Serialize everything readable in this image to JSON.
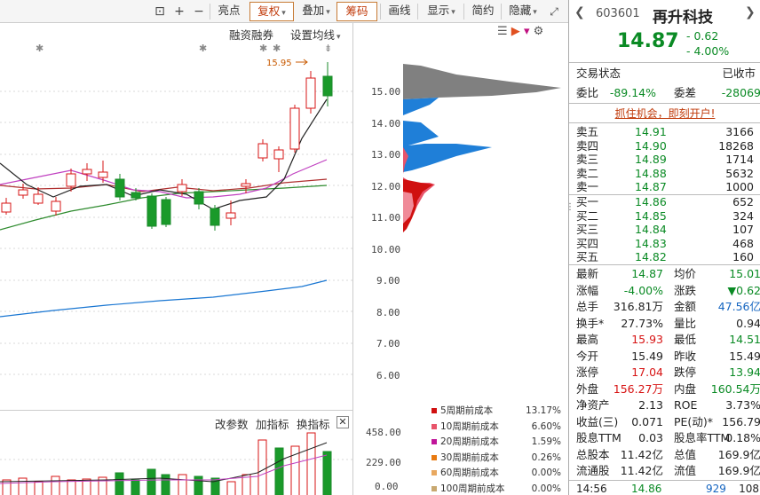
{
  "toolbar": {
    "buttons": [
      "亮点",
      "复权",
      "叠加",
      "筹码",
      "画线",
      "显示",
      "简约",
      "隐藏"
    ]
  },
  "chart": {
    "margin_label": "融资融券",
    "ma_label": "设置均线",
    "price_annotation": "15.95",
    "price_ticks": [
      "15.00",
      "14.00",
      "13.00",
      "12.00",
      "11.00",
      "10.00",
      "9.00",
      "8.00",
      "7.00",
      "6.00"
    ]
  },
  "volume": {
    "buttons": [
      "改参数",
      "加指标",
      "换指标"
    ],
    "ticks": [
      "458.00",
      "229.00",
      "0.00"
    ]
  },
  "chip_legend": [
    {
      "label": "5周期前成本",
      "pct": "13.17%",
      "color": "#d01010"
    },
    {
      "label": "10周期前成本",
      "pct": "6.60%",
      "color": "#e8546a"
    },
    {
      "label": "20周期前成本",
      "pct": "1.59%",
      "color": "#c0159a"
    },
    {
      "label": "30周期前成本",
      "pct": "0.26%",
      "color": "#e87a10"
    },
    {
      "label": "60周期前成本",
      "pct": "0.00%",
      "color": "#e8a860"
    },
    {
      "label": "100周期前成本",
      "pct": "0.00%",
      "color": "#c8a870"
    }
  ],
  "quote": {
    "code": "603601",
    "name": "再升科技",
    "price": "14.87",
    "change": "- 0.62",
    "change_pct": "- 4.00%",
    "trade_state_label": "交易状态",
    "trade_state": "已收市",
    "weibi_label": "委比",
    "weibi": "-89.14%",
    "weicha_label": "委差",
    "weicha": "-28069",
    "promo": "抓住机会，即刻开户!",
    "asks": [
      {
        "label": "卖五",
        "price": "14.91",
        "vol": "3166"
      },
      {
        "label": "卖四",
        "price": "14.90",
        "vol": "18268"
      },
      {
        "label": "卖三",
        "price": "14.89",
        "vol": "1714"
      },
      {
        "label": "卖二",
        "price": "14.88",
        "vol": "5632"
      },
      {
        "label": "卖一",
        "price": "14.87",
        "vol": "1000"
      }
    ],
    "bids": [
      {
        "label": "买一",
        "price": "14.86",
        "vol": "652"
      },
      {
        "label": "买二",
        "price": "14.85",
        "vol": "324"
      },
      {
        "label": "买三",
        "price": "14.84",
        "vol": "107"
      },
      {
        "label": "买四",
        "price": "14.83",
        "vol": "468"
      },
      {
        "label": "买五",
        "price": "14.82",
        "vol": "160"
      }
    ],
    "stats": [
      {
        "l1": "最新",
        "v1": "14.87",
        "c1": "g",
        "l2": "均价",
        "v2": "15.01",
        "c2": "g"
      },
      {
        "l1": "涨幅",
        "v1": "-4.00%",
        "c1": "g",
        "l2": "涨跌",
        "v2": "▼0.62",
        "c2": "g"
      },
      {
        "l1": "总手",
        "v1": "316.81万",
        "c1": "",
        "l2": "金额",
        "v2": "47.56亿",
        "c2": "b"
      },
      {
        "l1": "换手*",
        "v1": "27.73%",
        "c1": "",
        "l2": "量比",
        "v2": "0.94",
        "c2": ""
      },
      {
        "l1": "最高",
        "v1": "15.93",
        "c1": "r",
        "l2": "最低",
        "v2": "14.51",
        "c2": "g"
      },
      {
        "l1": "今开",
        "v1": "15.49",
        "c1": "",
        "l2": "昨收",
        "v2": "15.49",
        "c2": ""
      },
      {
        "l1": "涨停",
        "v1": "17.04",
        "c1": "r",
        "l2": "跌停",
        "v2": "13.94",
        "c2": "g"
      },
      {
        "l1": "外盘",
        "v1": "156.27万",
        "c1": "r",
        "l2": "内盘",
        "v2": "160.54万",
        "c2": "g"
      },
      {
        "l1": "净资产",
        "v1": "2.13",
        "c1": "",
        "l2": "ROE",
        "v2": "3.73%",
        "c2": ""
      },
      {
        "l1": "收益(三)",
        "v1": "0.071",
        "c1": "",
        "l2": "PE(动)*",
        "v2": "156.79",
        "c2": ""
      },
      {
        "l1": "股息TTM",
        "v1": "0.03",
        "c1": "",
        "l2": "股息率TTM",
        "v2": "0.18%",
        "c2": ""
      },
      {
        "l1": "总股本",
        "v1": "11.42亿",
        "c1": "",
        "l2": "总值",
        "v2": "169.9亿",
        "c2": ""
      },
      {
        "l1": "流通股",
        "v1": "11.42亿",
        "c1": "",
        "l2": "流值",
        "v2": "169.9亿",
        "c2": ""
      }
    ],
    "tick": {
      "time": "14:56",
      "price": "14.86",
      "vol": "929",
      "num": "108"
    }
  }
}
